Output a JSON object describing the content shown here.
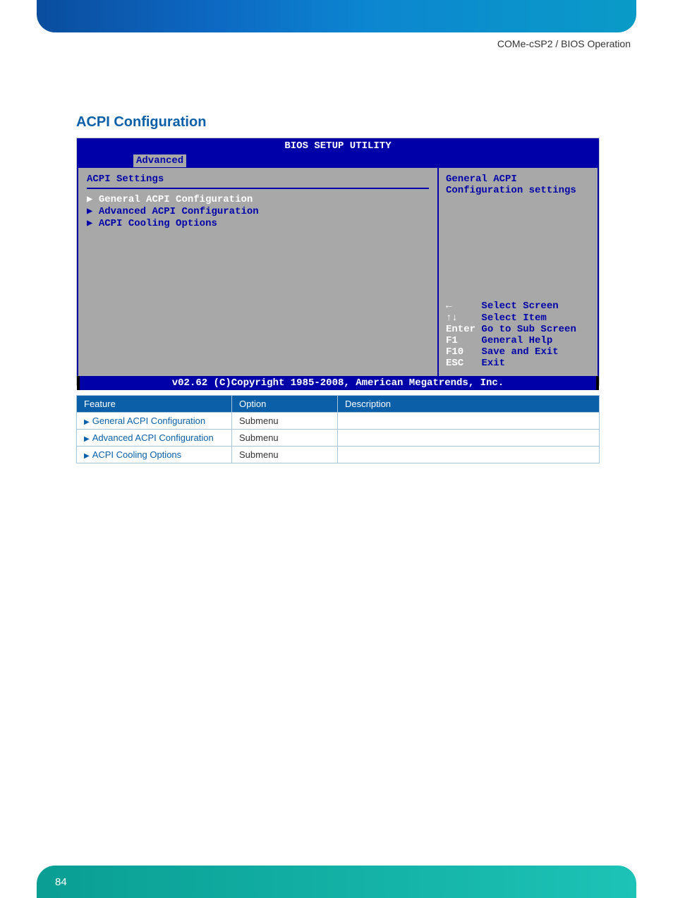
{
  "breadcrumb": "COMe-cSP2 / BIOS Operation",
  "section_title": "ACPI Configuration",
  "bios": {
    "title": "BIOS SETUP UTILITY",
    "tab": "Advanced",
    "panel_title": "ACPI Settings",
    "items": [
      "General ACPI Configuration",
      "Advanced ACPI Configuration",
      "ACPI Cooling Options"
    ],
    "side_desc_line1": "General ACPI",
    "side_desc_line2": "Configuration settings",
    "help": {
      "k1": "←",
      "v1": "Select Screen",
      "k2": "↑↓",
      "v2": "Select Item",
      "k3": "Enter",
      "v3": "Go to Sub Screen",
      "k4": "F1",
      "v4": "General Help",
      "k5": "F10",
      "v5": "Save and Exit",
      "k6": "ESC",
      "v6": "Exit"
    },
    "footer": "v02.62 (C)Copyright 1985-2008, American Megatrends, Inc."
  },
  "table": {
    "headers": {
      "c1": "Feature",
      "c2": "Option",
      "c3": "Description"
    },
    "rows": [
      {
        "feature": "General ACPI Configuration",
        "option": "Submenu",
        "desc": ""
      },
      {
        "feature": "Advanced ACPI Configuration",
        "option": "Submenu",
        "desc": ""
      },
      {
        "feature": "ACPI Cooling Options",
        "option": "Submenu",
        "desc": ""
      }
    ]
  },
  "page_number": "84"
}
